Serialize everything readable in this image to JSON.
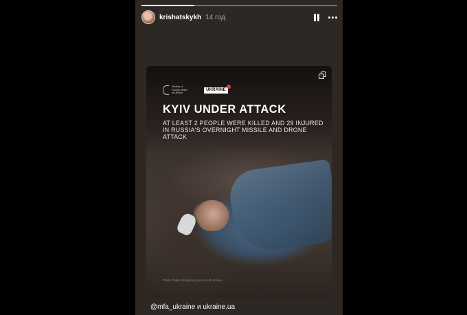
{
  "story": {
    "progress": 0.27,
    "username": "krishatskykh",
    "time": "14 год.",
    "mention_text": "@mfa_ukraine и ukraine.ua",
    "controls": {
      "pause_icon": "pause-icon",
      "more_icon": "more-horizontal-icon"
    }
  },
  "post": {
    "mfa_logo_text": "Ministry of\nForeign Affairs\nof Ukraine",
    "ukraine_badge": "UKRAINE",
    "headline": "KYIV UNDER ATTACK",
    "subline": "AT LEAST 2 PEOPLE WERE KILLED AND 29 INJURED IN RUSSIA'S OVERNIGHT MISSILE AND DRONE ATTACK",
    "credit": "Photo: State Emergency Service of Ukraine",
    "multi_icon": "carousel-icon"
  }
}
